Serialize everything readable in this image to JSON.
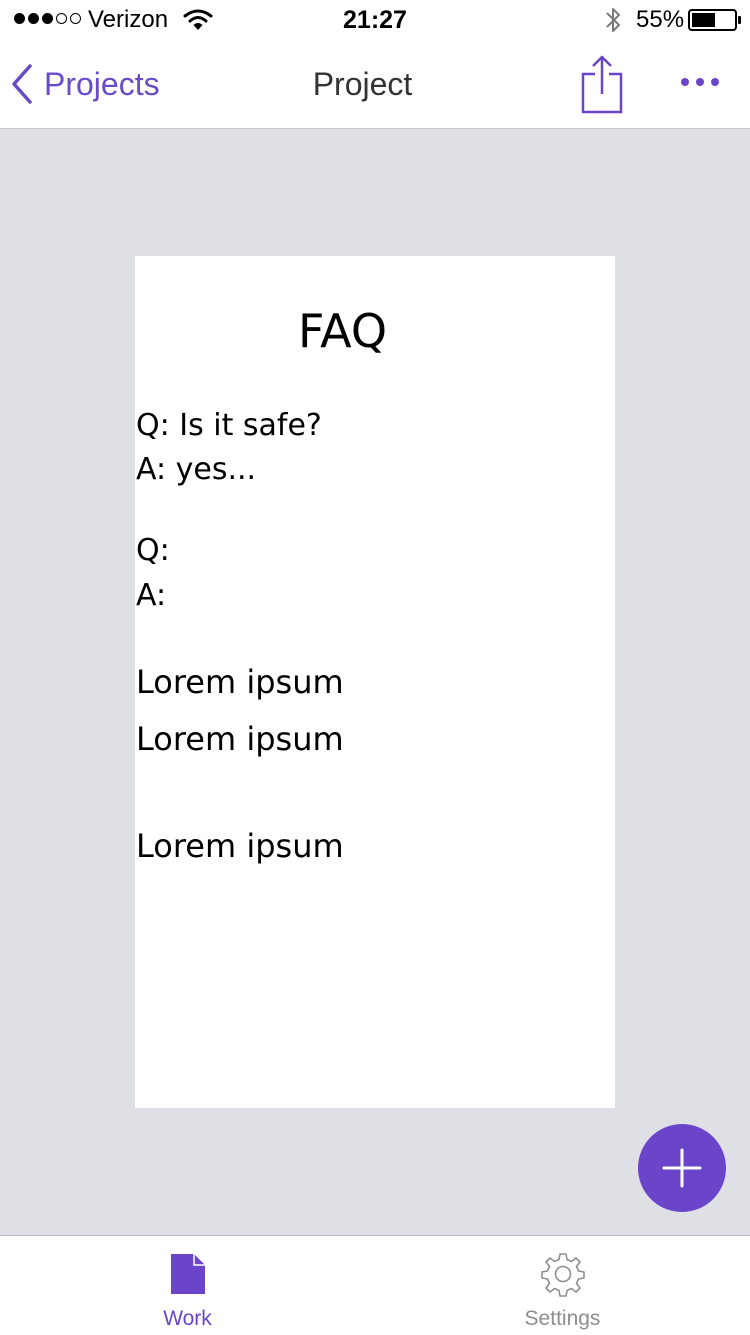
{
  "status_bar": {
    "carrier": "Verizon",
    "time": "21:27",
    "battery": "55%",
    "signal_bars_filled": 3,
    "signal_bars_total": 5
  },
  "nav": {
    "back_label": "Projects",
    "title": "Project"
  },
  "document": {
    "title": "FAQ",
    "lines": [
      "Q: Is it safe?",
      "A: yes...",
      "Q:",
      "A:",
      "Lorem ipsum",
      "Lorem ipsum",
      "Lorem ipsum"
    ]
  },
  "tabs": [
    {
      "label": "Work",
      "icon": "document-icon",
      "selected": true
    },
    {
      "label": "Settings",
      "icon": "gear-icon",
      "selected": false
    }
  ],
  "colors": {
    "accent": "#6a45c9",
    "canvas_background": "#dfdfe6",
    "tab_inactive": "#8e8e93"
  }
}
